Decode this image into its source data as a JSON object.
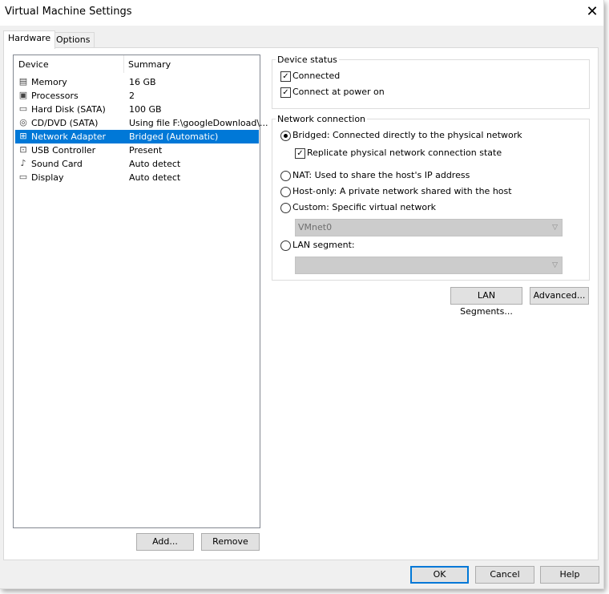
{
  "window": {
    "title": "Virtual Machine Settings",
    "close_symbol": "✕"
  },
  "tabs": [
    {
      "label": "Hardware",
      "active": true
    },
    {
      "label": "Options",
      "active": false
    }
  ],
  "device_list": {
    "headers": {
      "device": "Device",
      "summary": "Summary"
    },
    "items": [
      {
        "icon": "memory-icon",
        "glyph": "▤",
        "device": "Memory",
        "summary": "16 GB",
        "selected": false
      },
      {
        "icon": "processor-icon",
        "glyph": "▣",
        "device": "Processors",
        "summary": "2",
        "selected": false
      },
      {
        "icon": "hard-disk-icon",
        "glyph": "▭",
        "device": "Hard Disk (SATA)",
        "summary": "100 GB",
        "selected": false
      },
      {
        "icon": "cd-dvd-icon",
        "glyph": "◎",
        "device": "CD/DVD (SATA)",
        "summary": "Using file F:\\googleDownload\\...",
        "selected": false
      },
      {
        "icon": "network-adapter-icon",
        "glyph": "⊞",
        "device": "Network Adapter",
        "summary": "Bridged (Automatic)",
        "selected": true
      },
      {
        "icon": "usb-icon",
        "glyph": "⊡",
        "device": "USB Controller",
        "summary": "Present",
        "selected": false
      },
      {
        "icon": "sound-card-icon",
        "glyph": "♪",
        "device": "Sound Card",
        "summary": "Auto detect",
        "selected": false
      },
      {
        "icon": "display-icon",
        "glyph": "▭",
        "device": "Display",
        "summary": "Auto detect",
        "selected": false
      }
    ],
    "add_label": "Add...",
    "remove_label": "Remove"
  },
  "device_status": {
    "title": "Device status",
    "connected": {
      "label": "Connected",
      "checked": true
    },
    "connect_at_power_on": {
      "label": "Connect at power on",
      "checked": true
    }
  },
  "network_connection": {
    "title": "Network connection",
    "bridged": {
      "label": "Bridged: Connected directly to the physical network",
      "selected": true
    },
    "replicate": {
      "label": "Replicate physical network connection state",
      "checked": true
    },
    "nat": {
      "label": "NAT: Used to share the host's IP address",
      "selected": false
    },
    "host_only": {
      "label": "Host-only: A private network shared with the host",
      "selected": false
    },
    "custom": {
      "label": "Custom: Specific virtual network",
      "selected": false
    },
    "custom_network_value": "VMnet0",
    "lan_segment": {
      "label": "LAN segment:",
      "selected": false
    },
    "lan_segment_value": "",
    "lan_segments_button": "LAN Segments...",
    "advanced_button": "Advanced..."
  },
  "footer": {
    "ok": "OK",
    "cancel": "Cancel",
    "help": "Help"
  },
  "colors": {
    "selection": "#0078d7",
    "dialog_bg": "#f0f0f0",
    "disabled_combo": "#cccccc"
  }
}
